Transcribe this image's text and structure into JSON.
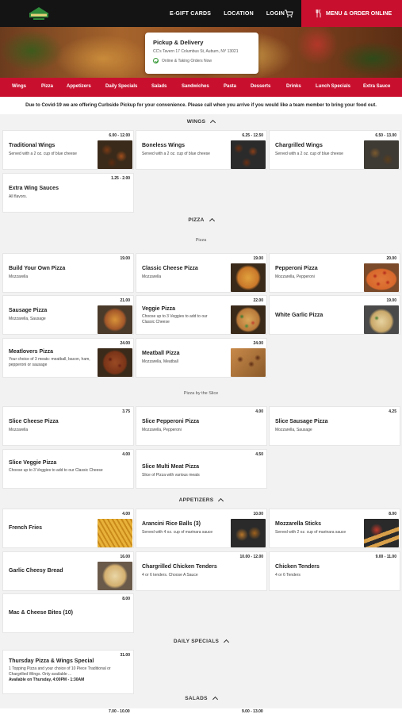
{
  "header": {
    "links": [
      "E-GIFT CARDS",
      "LOCATION",
      "LOGIN"
    ],
    "order_label": "MENU & ORDER ONLINE",
    "logo_icon": "restaurant-logo",
    "cart_icon": "cart-icon",
    "accent": "#c8102e"
  },
  "pickup": {
    "title": "Pickup & Delivery",
    "address": "CC's Tavern 17 Columbus St, Auburn, NY 13021",
    "status": "Online & Taking Orders Now"
  },
  "categories": [
    "Wings",
    "Pizza",
    "Appetizers",
    "Daily Specials",
    "Salads",
    "Sandwiches",
    "Pasta",
    "Desserts",
    "Drinks",
    "Lunch Specials",
    "Extra Sauce"
  ],
  "notice": "Due to Covid-19 we are offering Curbside Pickup for your convenience. Please call when you arrive if you would like a team member to bring your food out.",
  "sections": {
    "wings": {
      "title": "WINGS",
      "items": [
        {
          "name": "Traditional Wings",
          "desc": "Served with a 2 oz. cup of blue cheese",
          "price": "6.00 - 12.00"
        },
        {
          "name": "Boneless Wings",
          "desc": "Served with a 2 oz. cup of blue cheese",
          "price": "6.25 - 12.50"
        },
        {
          "name": "Chargrilled Wings",
          "desc": "Served with a 2 oz. cup of blue cheese",
          "price": "6.50 - 13.00"
        },
        {
          "name": "Extra Wing Sauces",
          "desc": "All flavors.",
          "price": "1.25 - 2.00"
        }
      ]
    },
    "pizza": {
      "title": "PIZZA",
      "sub1": "Pizza",
      "sub2": "Pizza by the Slice",
      "items": [
        {
          "name": "Build Your Own Pizza",
          "desc": "Mozzarella",
          "price": "19.00"
        },
        {
          "name": "Classic Cheese Pizza",
          "desc": "Mozzarella",
          "price": "19.00"
        },
        {
          "name": "Pepperoni Pizza",
          "desc": "Mozzarella, Pepperoni",
          "price": "20.00"
        },
        {
          "name": "Sausage Pizza",
          "desc": "Mozzarella, Sausage",
          "price": "21.00"
        },
        {
          "name": "Veggie Pizza",
          "desc": "Choose up to 3 Veggies to add to our Classic Cheese",
          "price": "22.00"
        },
        {
          "name": "White Garlic Pizza",
          "desc": "",
          "price": "19.00"
        },
        {
          "name": "Meatlovers Pizza",
          "desc": "Your choice of 3 meats: meatball, bacon, ham, pepperoni or sausage",
          "price": "24.00"
        },
        {
          "name": "Meatball Pizza",
          "desc": "Mozzarella, Meatball",
          "price": "24.00"
        }
      ],
      "slices": [
        {
          "name": "Slice Cheese Pizza",
          "desc": "Mozzarella",
          "price": "3.75"
        },
        {
          "name": "Slice Pepperoni Pizza",
          "desc": "Mozzarella, Pepperoni",
          "price": "4.00"
        },
        {
          "name": "Slice Sausage Pizza",
          "desc": "Mozzarella, Sausage",
          "price": "4.25"
        },
        {
          "name": "Slice Veggie Pizza",
          "desc": "Choose up to 3 Veggies to add to our Classic Cheese",
          "price": "4.00"
        },
        {
          "name": "Slice Multi Meat Pizza",
          "desc": "Slice of Pizza with various meats",
          "price": "4.50"
        }
      ]
    },
    "appetizers": {
      "title": "APPETIZERS",
      "items": [
        {
          "name": "French Fries",
          "desc": "",
          "price": "4.00"
        },
        {
          "name": "Arancini Rice Balls (3)",
          "desc": "Served with 4 oz. cup of marinara sauce",
          "price": "10.00"
        },
        {
          "name": "Mozzarella Sticks",
          "desc": "Served with 2 oz. cup of marinara sauce",
          "price": "8.00"
        },
        {
          "name": "Garlic Cheesy Bread",
          "desc": "",
          "price": "16.00"
        },
        {
          "name": "Chargrilled Chicken Tenders",
          "desc": "4 or 6 tenders. Choose A Sauce",
          "price": "10.00 - 12.00"
        },
        {
          "name": "Chicken Tenders",
          "desc": "4 or 6 Tenders",
          "price": "9.00 - 11.00"
        },
        {
          "name": "Mac & Cheese Bites (10)",
          "desc": "",
          "price": "8.00"
        }
      ]
    },
    "daily": {
      "title": "DAILY SPECIALS",
      "items": [
        {
          "name": "Thursday Pizza & Wings Special",
          "desc": "1 Topping Pizza and your choice of 10 Piece Traditional or Chargrilled Wings. Only available ...",
          "avail": "Available on Thursday, 4:00PM - 1:30AM",
          "price": "31.00"
        }
      ]
    },
    "salads": {
      "title": "SALADS",
      "prices": [
        "7.00 - 10.00",
        "9.00 - 13.00"
      ]
    }
  }
}
